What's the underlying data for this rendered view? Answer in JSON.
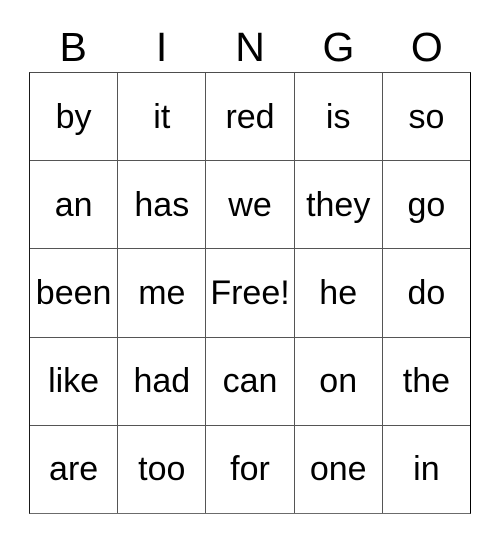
{
  "card": {
    "title": "BINGO",
    "columns": [
      "B",
      "I",
      "N",
      "G",
      "O"
    ],
    "text_color": "#000000",
    "border_color": "#555555",
    "background_color": "#ffffff",
    "rows": [
      {
        "cells": [
          "by",
          "it",
          "red",
          "is",
          "so"
        ]
      },
      {
        "cells": [
          "an",
          "has",
          "we",
          "they",
          "go"
        ]
      },
      {
        "cells": [
          "been",
          "me",
          "Free!",
          "he",
          "do"
        ]
      },
      {
        "cells": [
          "like",
          "had",
          "can",
          "on",
          "the"
        ]
      },
      {
        "cells": [
          "are",
          "too",
          "for",
          "one",
          "in"
        ]
      }
    ],
    "free_space": {
      "row": 2,
      "col": 2,
      "label": "Free!"
    }
  }
}
